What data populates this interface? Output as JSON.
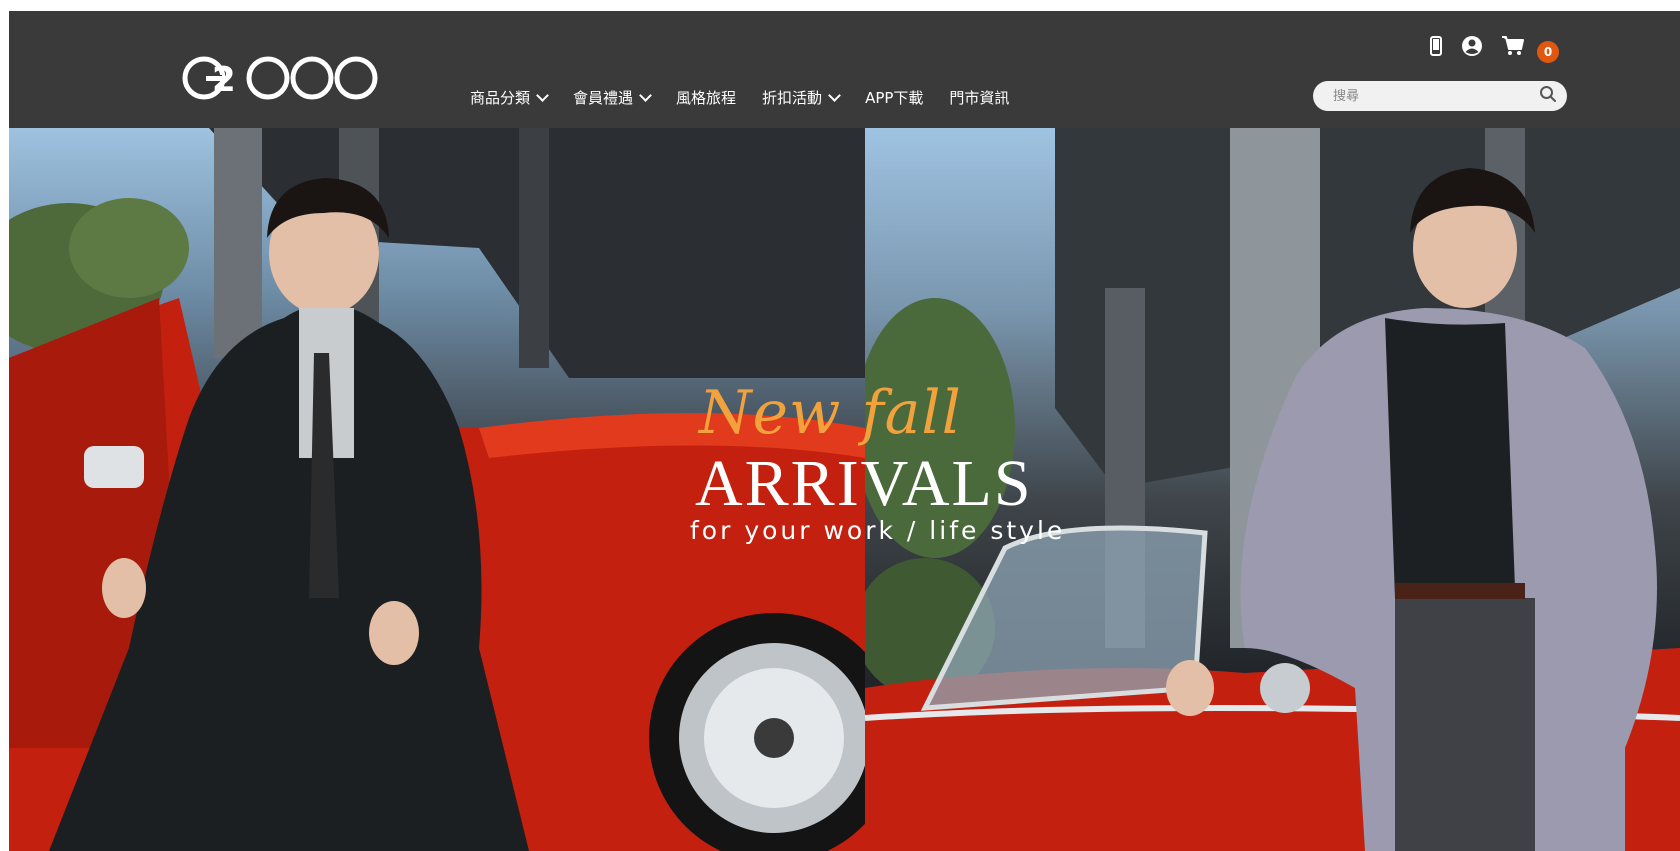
{
  "brand": {
    "logo_text": "G2000"
  },
  "nav": {
    "items": [
      {
        "label": "商品分類",
        "has_dropdown": true
      },
      {
        "label": "會員禮遇",
        "has_dropdown": true
      },
      {
        "label": "風格旅程",
        "has_dropdown": false
      },
      {
        "label": "折扣活動",
        "has_dropdown": true
      },
      {
        "label": "APP下載",
        "has_dropdown": false
      },
      {
        "label": "門市資訊",
        "has_dropdown": false
      }
    ]
  },
  "header_icons": {
    "phone": "mobile-phone-icon",
    "account": "user-account-icon",
    "cart": "shopping-cart-icon",
    "cart_count": "0"
  },
  "search": {
    "placeholder": "搜尋",
    "icon": "search-icon"
  },
  "hero": {
    "headline_script": "New fall",
    "headline_main": "ARRIVALS",
    "tagline": "for your work / life style"
  },
  "colors": {
    "header_bg": "#3a3a3a",
    "cart_badge": "#e0580f",
    "headline_script": "#f2a23c",
    "car_red": "#c4200f"
  }
}
